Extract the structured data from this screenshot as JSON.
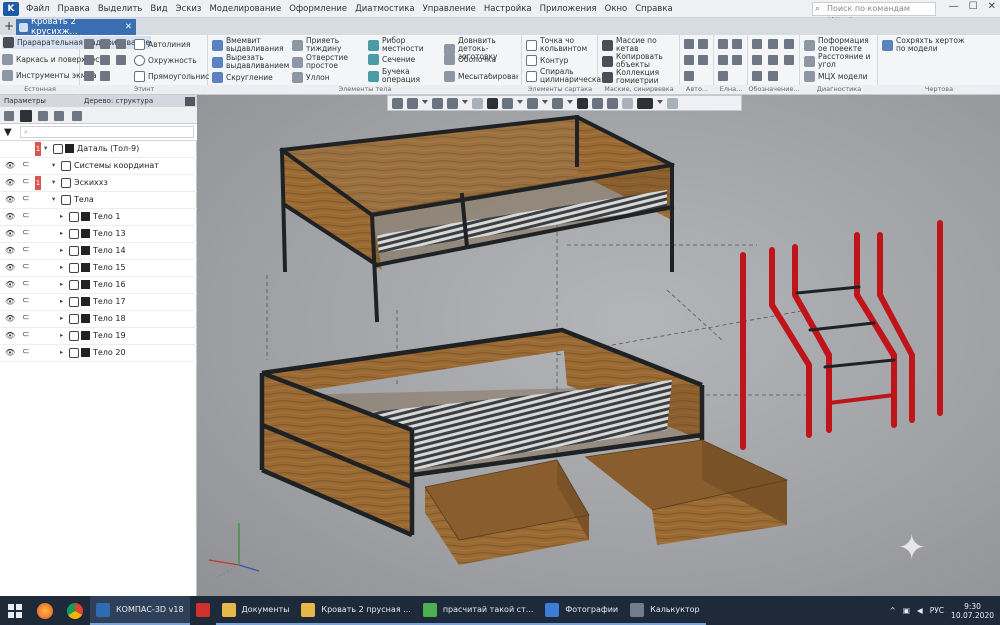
{
  "app": {
    "logo_letter": "K",
    "menu": [
      "Файл",
      "Правка",
      "Выделить",
      "Вид",
      "Эскиз",
      "Моделирование",
      "Оформление",
      "Диатмостика",
      "Управление",
      "Настройка",
      "Приложения",
      "Окно",
      "Справка"
    ],
    "search_placeholder": "Поиск по командам (Alt+/)",
    "window_controls": [
      "—",
      "☐",
      "✕"
    ]
  },
  "tabs": {
    "plus": "+",
    "document": "Кровать 2 крусихж...",
    "close": "✕"
  },
  "ribbon": {
    "groups": [
      {
        "label": "Естонная",
        "items": [
          "Прарарательная мадафицйвание",
          "Каркась и поверхности",
          "Инструменты экмма"
        ]
      },
      {
        "label": "Этинт",
        "items": [
          "Автолиния",
          "Охружность",
          "Прямоугольнис"
        ]
      },
      {
        "label": "Элементы тела",
        "items": [
          "Вмемвит выдавливания",
          "Вырезать выдавливанием",
          "Скругление",
          "Прияеть тиждину",
          "Отверстие простое",
          "Уллон",
          "Рибор местности",
          "Сечение",
          "Бучека операция",
          "Довнвить детокь-зоготовку",
          "Оболочка",
          "Месытабирование"
        ]
      },
      {
        "label": "Элементы сартака",
        "items": [
          "Точка чо кольвинтом",
          "Контур",
          "Спираль цилинарическая"
        ]
      },
      {
        "label": "Маские, синирвевка",
        "items": [
          "Массие по кетав",
          "Копировать объекты",
          "Коллекция гомиетрии"
        ]
      },
      {
        "label": "Авто...",
        "items": []
      },
      {
        "label": "Елна...",
        "items": []
      },
      {
        "label": "Обозначение...",
        "items": []
      },
      {
        "label": "Диагностика",
        "items": [
          "Поформация ое поеекте",
          "Расстояние и угол",
          "МЦХ модели"
        ]
      },
      {
        "label": "Чертова",
        "items": [
          "Сохряхть хертож по модели"
        ]
      }
    ]
  },
  "left_panel": {
    "tab_params": "Параметры",
    "tab_tree": "Дерево: структура",
    "filter_placeholder": "⌕",
    "tree": [
      {
        "label": "Даталь (Тол-9)",
        "badge": "1",
        "indent": 0,
        "eye": false
      },
      {
        "label": "Системы координат",
        "badge": "",
        "indent": 1,
        "eye": true
      },
      {
        "label": "Эскиххз",
        "badge": "1",
        "indent": 1,
        "eye": true
      },
      {
        "label": "Тела",
        "badge": "",
        "indent": 1,
        "eye": true
      },
      {
        "label": "Тело 1",
        "badge": "",
        "indent": 2,
        "eye": true
      },
      {
        "label": "Тело 13",
        "badge": "",
        "indent": 2,
        "eye": true
      },
      {
        "label": "Тело 14",
        "badge": "",
        "indent": 2,
        "eye": true
      },
      {
        "label": "Тело 15",
        "badge": "",
        "indent": 2,
        "eye": true
      },
      {
        "label": "Тело 16",
        "badge": "",
        "indent": 2,
        "eye": true
      },
      {
        "label": "Тело 17",
        "badge": "",
        "indent": 2,
        "eye": true
      },
      {
        "label": "Тело 18",
        "badge": "",
        "indent": 2,
        "eye": true
      },
      {
        "label": "Тело 19",
        "badge": "",
        "indent": 2,
        "eye": true
      },
      {
        "label": "Тело 20",
        "badge": "",
        "indent": 2,
        "eye": true
      }
    ]
  },
  "viewport": {
    "colors": {
      "wood": "#9a6a34",
      "wood_dark": "#6e4a22",
      "frame": "#1f2224",
      "slat": "#d8d8d8",
      "ladder": "#c0141b"
    }
  },
  "taskbar": {
    "apps": [
      {
        "label": "КОМПАС-3D v18",
        "active": true,
        "color": "#2f6bb3"
      },
      {
        "label": "",
        "active": false,
        "color": "#d0312d"
      },
      {
        "label": "Документы",
        "active": false,
        "color": "#e6b84a"
      },
      {
        "label": "Кровать 2 прусная ...",
        "active": false,
        "color": "#e6b84a"
      },
      {
        "label": "прасчитай такой ст...",
        "active": false,
        "color": "#4caf50"
      },
      {
        "label": "Фотографии",
        "active": false,
        "color": "#3d7dd8"
      },
      {
        "label": "Калькуктор",
        "active": false,
        "color": "#6f7d8c"
      }
    ],
    "language": "РУС",
    "time": "9:30",
    "date": "10.07.2020"
  }
}
